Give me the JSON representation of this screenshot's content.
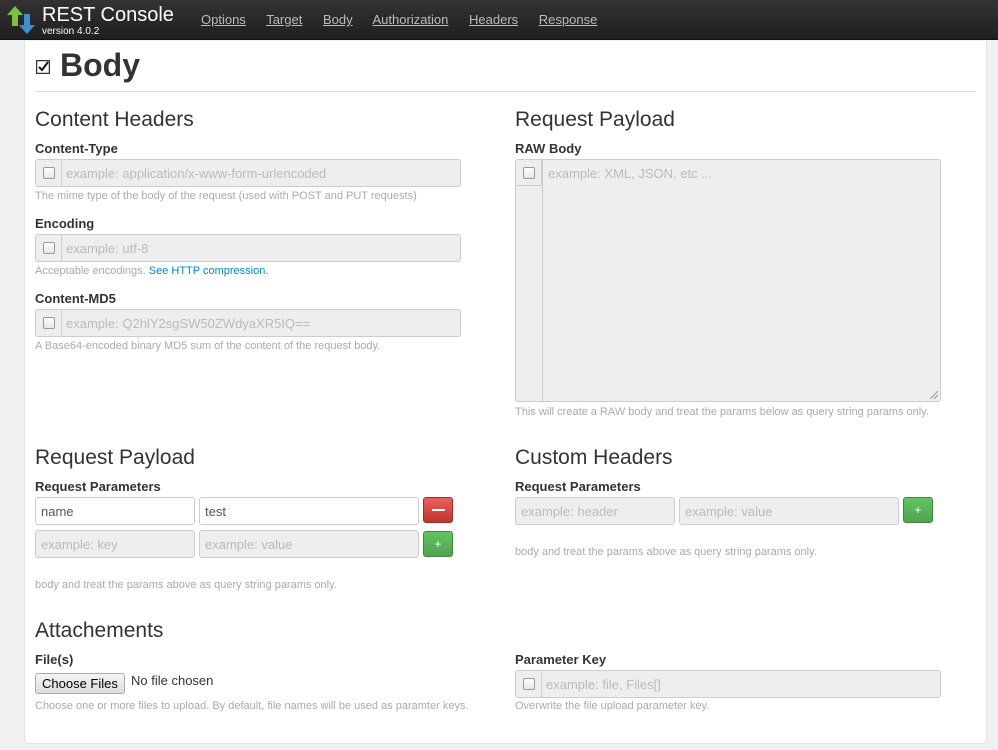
{
  "app": {
    "title": "REST Console",
    "version": "version 4.0.2"
  },
  "nav": [
    "Options",
    "Target",
    "Body",
    "Authorization",
    "Headers",
    "Response"
  ],
  "section": {
    "title": "Body"
  },
  "content_headers": {
    "heading": "Content Headers",
    "content_type": {
      "label": "Content-Type",
      "placeholder": "example: application/x-www-form-urlencoded",
      "help": "The mime type of the body of the request (used with POST and PUT requests)"
    },
    "encoding": {
      "label": "Encoding",
      "placeholder": "example: utf-8",
      "help": "Acceptable encodings.",
      "help_link": "See HTTP compression."
    },
    "content_md5": {
      "label": "Content-MD5",
      "placeholder": "example: Q2hlY2sgSW50ZWdyaXR5IQ==",
      "help": "A Base64-encoded binary MD5 sum of the content of the request body."
    }
  },
  "raw_payload": {
    "heading": "Request Payload",
    "label": "RAW Body",
    "placeholder": "example: XML, JSON, etc ...",
    "help": "This will create a RAW body and treat the params below as query string params only."
  },
  "request_payload": {
    "heading": "Request Payload",
    "label": "Request Parameters",
    "row1": {
      "key": "name",
      "value": "test",
      "button": "—"
    },
    "row2": {
      "key_placeholder": "example: key",
      "value_placeholder": "example: value",
      "button": "+"
    },
    "help": "body and treat the params above as query string params only."
  },
  "custom_headers": {
    "heading": "Custom Headers",
    "label": "Request Parameters",
    "header_placeholder": "example: header",
    "value_placeholder": "example: value",
    "button": "+",
    "help": "body and treat the params above as query string params only."
  },
  "attachments": {
    "heading": "Attachements",
    "files_label": "File(s)",
    "choose_button": "Choose Files",
    "file_status": "No file chosen",
    "files_help": "Choose one or more files to upload. By default, file names will be used as paramter keys.",
    "param_key_label": "Parameter Key",
    "param_key_placeholder": "example: file, Files[]",
    "param_key_help": "Overwrite the file upload parameter key."
  },
  "colors": {
    "navbar": "#222222",
    "danger": "#da4f49",
    "success": "#5bb75b",
    "link": "#0088cc"
  }
}
